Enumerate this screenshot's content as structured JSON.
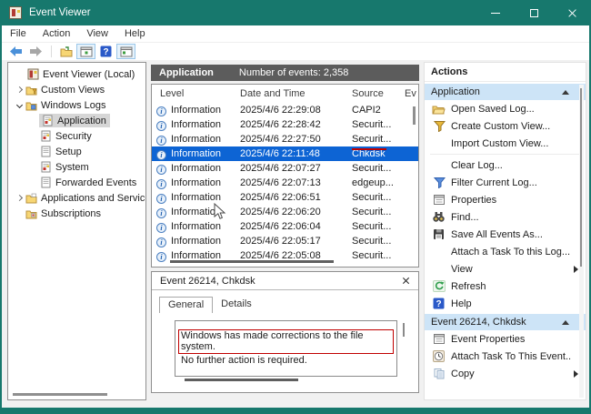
{
  "window": {
    "title": "Event Viewer"
  },
  "menu_bar": {
    "items": [
      "File",
      "Action",
      "View",
      "Help"
    ]
  },
  "toolbar": {
    "icons": [
      "back-icon",
      "forward-icon",
      "export-log-icon",
      "show-console-tree-icon",
      "help-icon",
      "show-action-pane-icon"
    ]
  },
  "colors": {
    "titlebar_teal": "#17786d",
    "list_header_gray": "#5c5c5c",
    "selection_blue": "#0d64d4",
    "section_header_blue": "#cde4f7",
    "tree_selection_gray": "#d6d6d6",
    "annotation_red": "#c00000"
  },
  "tree": {
    "items": [
      {
        "label": "Event Viewer (Local)",
        "icon": "event-viewer-icon",
        "expander": "none",
        "selected": false
      },
      {
        "label": "Custom Views",
        "icon": "folder-custom-views-icon",
        "expander": "collapsed",
        "selected": false
      },
      {
        "label": "Windows Logs",
        "icon": "folder-windows-logs-icon",
        "expander": "expanded",
        "selected": false
      },
      {
        "label": "Application",
        "icon": "log-file-icon",
        "expander": "none",
        "selected": true
      },
      {
        "label": "Security",
        "icon": "log-file-icon",
        "expander": "none",
        "selected": false
      },
      {
        "label": "Setup",
        "icon": "log-file-plain-icon",
        "expander": "none",
        "selected": false
      },
      {
        "label": "System",
        "icon": "log-file-icon",
        "expander": "none",
        "selected": false
      },
      {
        "label": "Forwarded Events",
        "icon": "log-file-plain-icon",
        "expander": "none",
        "selected": false
      },
      {
        "label": "Applications and Services Logs",
        "icon": "folder-icon",
        "expander": "collapsed",
        "selected": false
      },
      {
        "label": "Subscriptions",
        "icon": "folder-subscriptions-icon",
        "expander": "none",
        "selected": false
      }
    ]
  },
  "list_header": {
    "title": "Application",
    "events_count": "Number of events: 2,358"
  },
  "table": {
    "columns": [
      "Level",
      "Date and Time",
      "Source",
      "Ev"
    ],
    "selected_row": 3,
    "rows": [
      {
        "level": "Information",
        "datetime": "2025/4/6 22:29:08",
        "source": "CAPI2"
      },
      {
        "level": "Information",
        "datetime": "2025/4/6 22:28:42",
        "source": "Securit..."
      },
      {
        "level": "Information",
        "datetime": "2025/4/6 22:27:50",
        "source": "Securit..."
      },
      {
        "level": "Information",
        "datetime": "2025/4/6 22:11:48",
        "source": "Chkdsk"
      },
      {
        "level": "Information",
        "datetime": "2025/4/6 22:07:27",
        "source": "Securit..."
      },
      {
        "level": "Information",
        "datetime": "2025/4/6 22:07:13",
        "source": "edgeup..."
      },
      {
        "level": "Information",
        "datetime": "2025/4/6 22:06:51",
        "source": "Securit..."
      },
      {
        "level": "Information",
        "datetime": "2025/4/6 22:06:20",
        "source": "Securit..."
      },
      {
        "level": "Information",
        "datetime": "2025/4/6 22:06:04",
        "source": "Securit..."
      },
      {
        "level": "Information",
        "datetime": "2025/4/6 22:05:17",
        "source": "Securit..."
      },
      {
        "level": "Information",
        "datetime": "2025/4/6 22:05:08",
        "source": "Securit..."
      }
    ]
  },
  "event_panel": {
    "title": "Event 26214, Chkdsk",
    "tabs": [
      "General",
      "Details"
    ],
    "active_tab": "General",
    "message": [
      "Windows has made corrections to the file system.",
      "No further action is required."
    ]
  },
  "actions_panel": {
    "title": "Actions",
    "sections": [
      {
        "header": "Application",
        "items": [
          {
            "label": "Open Saved Log...",
            "icon": "open-saved-log-icon",
            "submenu": false
          },
          {
            "label": "Create Custom View...",
            "icon": "funnel-yellow-icon",
            "submenu": false
          },
          {
            "label": "Import Custom View...",
            "icon": "none",
            "submenu": false
          },
          {
            "label": "Clear Log...",
            "icon": "none",
            "submenu": false
          },
          {
            "label": "Filter Current Log...",
            "icon": "funnel-blue-icon",
            "submenu": false
          },
          {
            "label": "Properties",
            "icon": "properties-icon",
            "submenu": false
          },
          {
            "label": "Find...",
            "icon": "find-icon",
            "submenu": false
          },
          {
            "label": "Save All Events As...",
            "icon": "save-icon",
            "submenu": false
          },
          {
            "label": "Attach a Task To this Log...",
            "icon": "none",
            "submenu": false
          },
          {
            "label": "View",
            "icon": "none",
            "submenu": true
          },
          {
            "label": "Refresh",
            "icon": "refresh-icon",
            "submenu": false
          },
          {
            "label": "Help",
            "icon": "help-icon",
            "submenu": false
          }
        ]
      },
      {
        "header": "Event 26214, Chkdsk",
        "items": [
          {
            "label": "Event Properties",
            "icon": "properties-icon",
            "submenu": false
          },
          {
            "label": "Attach Task To This Event...",
            "icon": "clock-icon",
            "submenu": false
          },
          {
            "label": "Copy",
            "icon": "copy-icon",
            "submenu": true
          }
        ]
      }
    ]
  }
}
